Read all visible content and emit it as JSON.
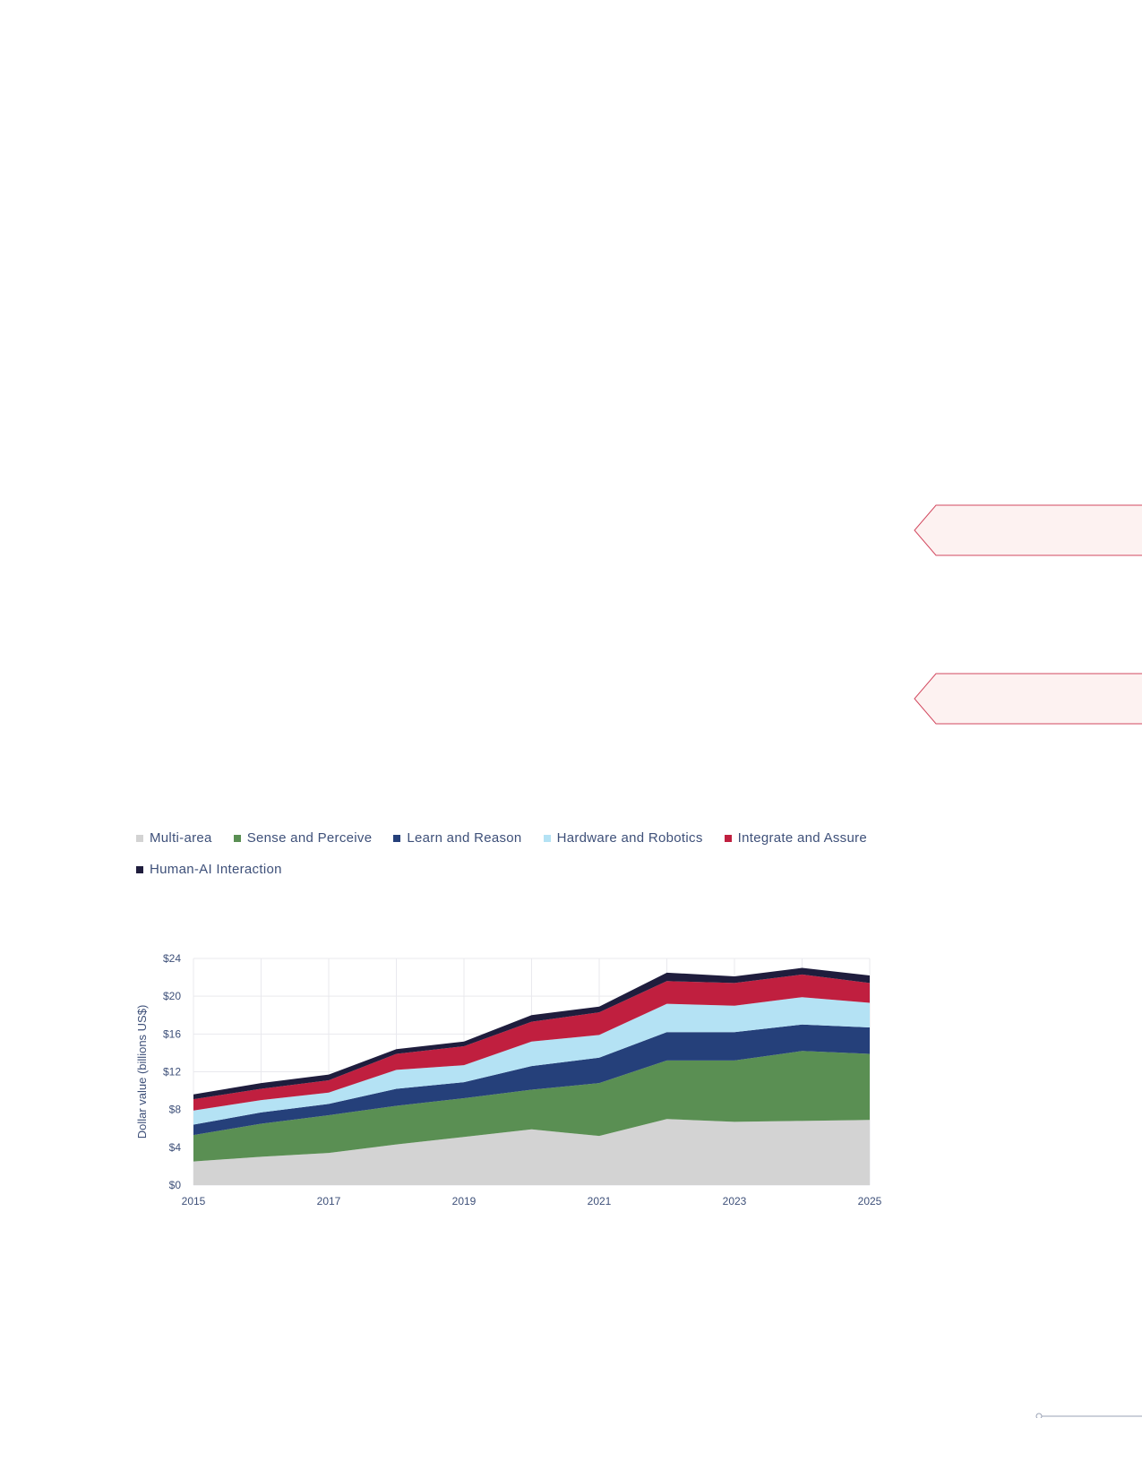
{
  "chart_data": {
    "type": "area",
    "stacked": true,
    "title": "",
    "xlabel": "",
    "ylabel": "Dollar value (billions US$)",
    "x": [
      2015,
      2016,
      2017,
      2018,
      2019,
      2020,
      2021,
      2022,
      2023,
      2024,
      2025
    ],
    "x_ticks": [
      "2015",
      "2017",
      "2019",
      "2021",
      "2023",
      "2025"
    ],
    "ylim": [
      0,
      24
    ],
    "y_ticks": [
      "$0",
      "$4",
      "$8",
      "$12",
      "$16",
      "$20",
      "$24"
    ],
    "grid": true,
    "legend_position": "top",
    "series": [
      {
        "name": "Multi-area",
        "color": "#d3d3d3",
        "values": [
          2.5,
          3.0,
          3.4,
          4.3,
          5.1,
          5.9,
          5.2,
          7.0,
          6.7,
          6.8,
          6.9
        ]
      },
      {
        "name": "Sense and Perceive",
        "color": "#5a8f53",
        "values": [
          2.8,
          3.5,
          4.0,
          4.1,
          4.1,
          4.2,
          5.6,
          6.2,
          6.5,
          7.4,
          7.0
        ]
      },
      {
        "name": "Learn and Reason",
        "color": "#25407a",
        "values": [
          1.1,
          1.2,
          1.2,
          1.8,
          1.7,
          2.5,
          2.7,
          3.0,
          3.0,
          2.8,
          2.8
        ]
      },
      {
        "name": "Hardware and Robotics",
        "color": "#b4e2f4",
        "values": [
          1.5,
          1.3,
          1.2,
          2.0,
          1.8,
          2.6,
          2.4,
          3.0,
          2.8,
          2.9,
          2.6
        ]
      },
      {
        "name": "Integrate and Assure",
        "color": "#c01f3f",
        "values": [
          1.2,
          1.2,
          1.3,
          1.7,
          2.0,
          2.1,
          2.4,
          2.4,
          2.4,
          2.4,
          2.1
        ]
      },
      {
        "name": "Human-AI Interaction",
        "color": "#1f1d3d",
        "values": [
          0.5,
          0.6,
          0.6,
          0.5,
          0.5,
          0.7,
          0.6,
          0.9,
          0.7,
          0.7,
          0.8
        ]
      }
    ]
  },
  "colors": {
    "axis_text": "#3e5079",
    "grid": "#e9e9ee",
    "callout_fill": "#fdf2f1",
    "callout_stroke": "#d2485f",
    "page_rule": "#9aa2b5"
  }
}
